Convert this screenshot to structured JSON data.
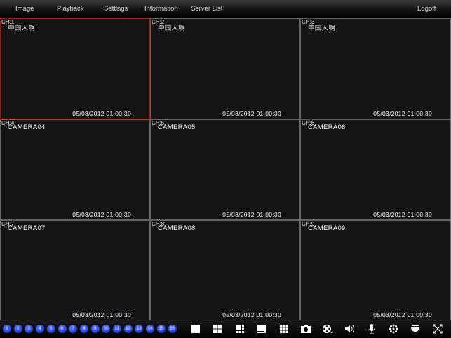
{
  "menu": {
    "items": [
      "Image",
      "Playback",
      "Settings",
      "Information",
      "Server List"
    ],
    "logoff": "Logoff"
  },
  "channels": [
    {
      "ch": "CH:1",
      "name": "中国人啊",
      "time": "05/03/2012 01:00:30",
      "selected": true
    },
    {
      "ch": "CH:2",
      "name": "中国人啊",
      "time": "05/03/2012 01:00:30"
    },
    {
      "ch": "CH:3",
      "name": "中国人啊",
      "time": "05/03/2012 01:00:30"
    },
    {
      "ch": "CH:4",
      "name": "CAMERA04",
      "time": "05/03/2012 01:00:30"
    },
    {
      "ch": "CH:5",
      "name": "CAMERA05",
      "time": "05/03/2012 01:00:30"
    },
    {
      "ch": "CH:6",
      "name": "CAMERA06",
      "time": "05/03/2012 01:00:30"
    },
    {
      "ch": "CH:7",
      "name": "CAMERA07",
      "time": "05/03/2012 01:00:30"
    },
    {
      "ch": "CH:8",
      "name": "CAMERA08",
      "time": "05/03/2012 01:00:30"
    },
    {
      "ch": "CH:9",
      "name": "CAMERA09",
      "time": "05/03/2012 01:00:30"
    }
  ],
  "channel_buttons": [
    "1",
    "2",
    "3",
    "4",
    "5",
    "6",
    "7",
    "8",
    "9",
    "10",
    "11",
    "12",
    "13",
    "14",
    "15",
    "16"
  ],
  "tools": [
    "layout-1-icon",
    "layout-4-icon",
    "layout-6-icon",
    "layout-8-icon",
    "layout-9-icon",
    "camera-snapshot-icon",
    "record-film-icon",
    "speaker-icon",
    "microphone-icon",
    "ptz-settings-icon",
    "dome-camera-icon",
    "fullscreen-icon"
  ],
  "colors": {
    "selected": "#dd0000",
    "channel_button": "#1b3be0"
  }
}
